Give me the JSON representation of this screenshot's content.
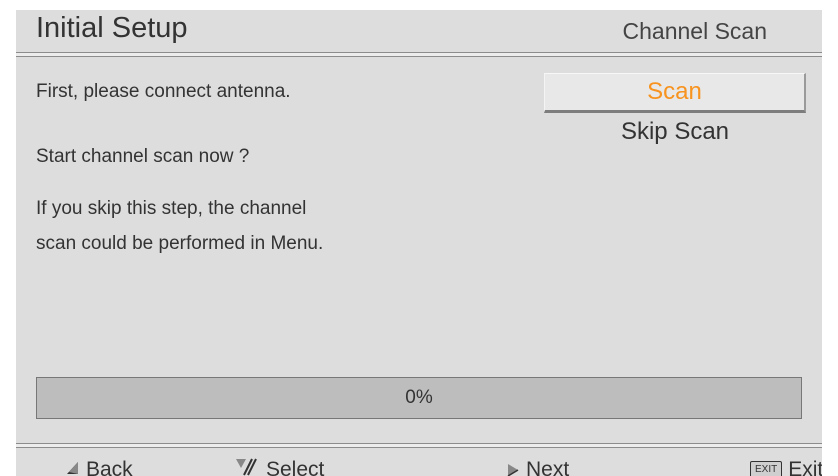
{
  "header": {
    "title": "Initial Setup",
    "step": "Channel Scan"
  },
  "body": {
    "line1": "First, please connect antenna.",
    "line2": "Start channel scan now ?",
    "line3": "If you skip this step, the channel",
    "line4": "scan could be performed in Menu."
  },
  "options": {
    "scan_label": "Scan",
    "skip_label": "Skip Scan",
    "selected": "Scan"
  },
  "progress": {
    "value": 0,
    "label": "0%"
  },
  "footer": {
    "back_label": "Back",
    "select_label": "Select",
    "next_label": "Next",
    "exit_label": "Exit",
    "exit_key_text": "EXIT"
  },
  "colors": {
    "background": "#dddddd",
    "highlight": "#f7931e",
    "text": "#333333"
  },
  "icons": {
    "back": "left-arrow-icon",
    "select": "up-down-arrow-icon",
    "next": "right-arrow-icon",
    "exit": "exit-key-icon"
  }
}
